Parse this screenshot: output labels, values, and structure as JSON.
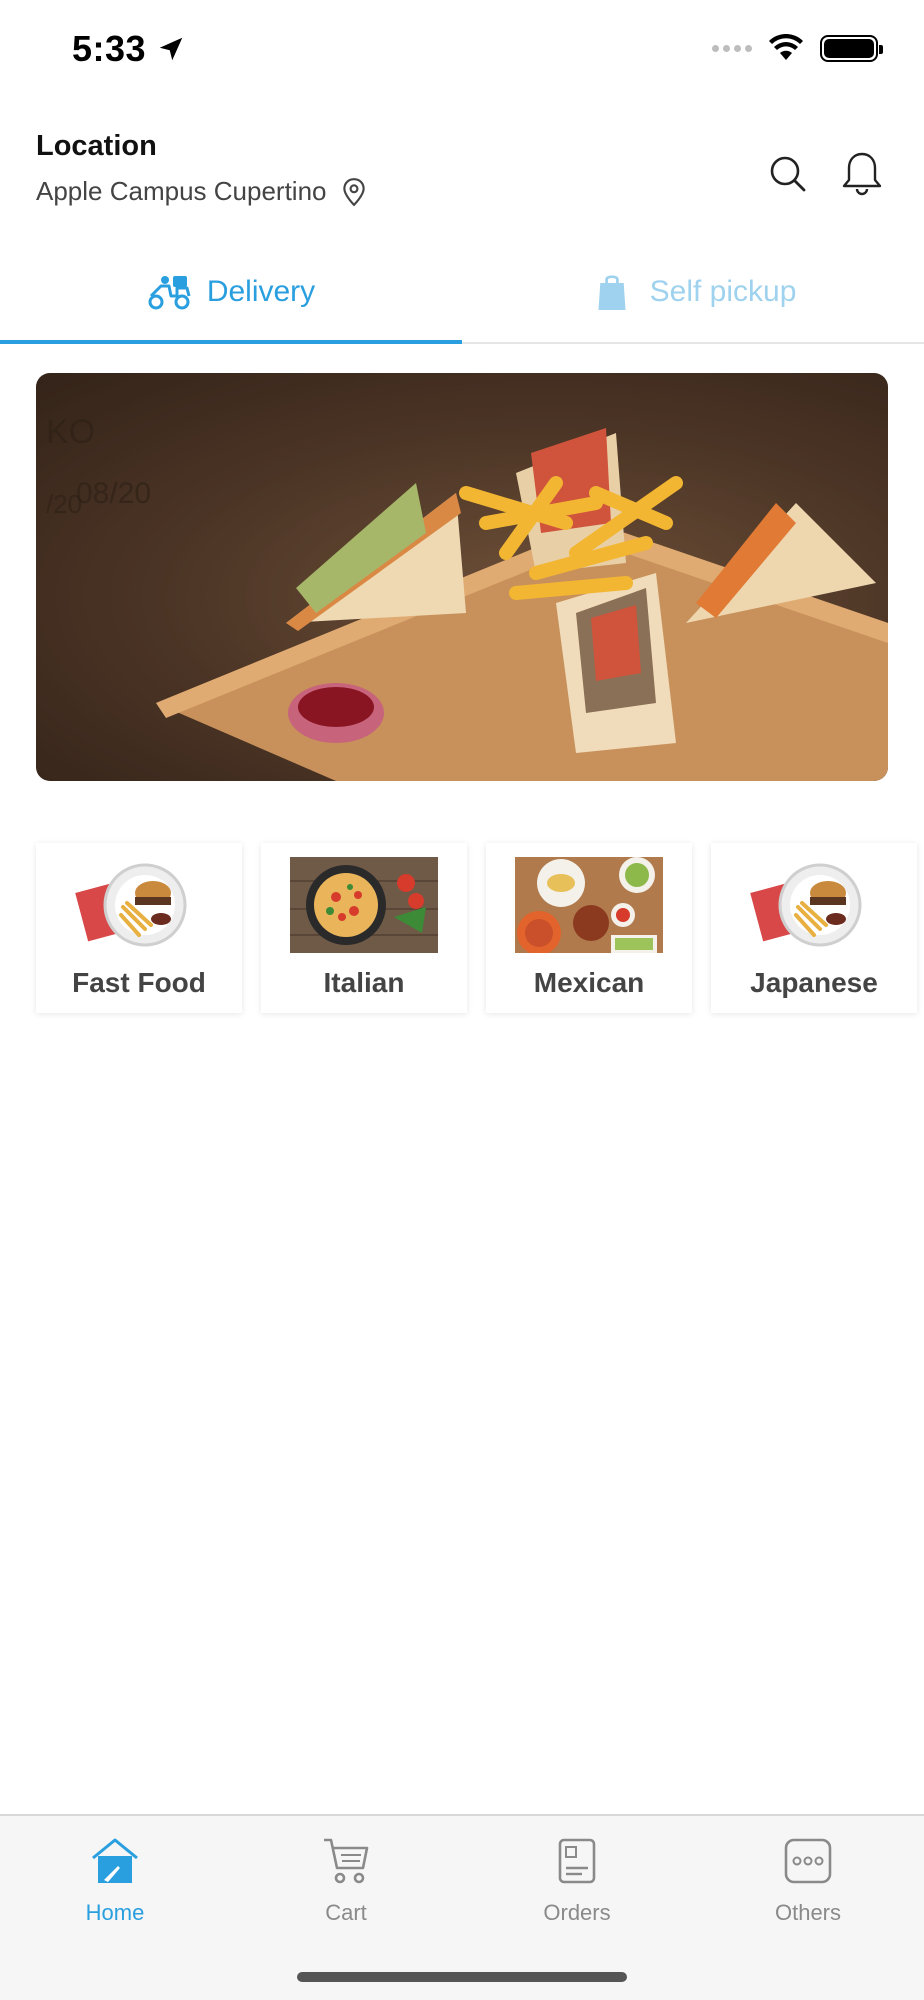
{
  "status_bar": {
    "time": "5:33"
  },
  "header": {
    "location_title": "Location",
    "location_value": "Apple Campus Cupertino"
  },
  "tabs": [
    {
      "label": "Delivery",
      "icon": "scooter-icon",
      "active": true
    },
    {
      "label": "Self pickup",
      "icon": "shopping-bag-icon",
      "active": false
    }
  ],
  "banner": {
    "image": "club sandwich with fries and ketchup on a wooden board"
  },
  "categories": [
    {
      "label": "Fast Food",
      "icon": "burger-plate-image"
    },
    {
      "label": "Italian",
      "icon": "pasta-image"
    },
    {
      "label": "Mexican",
      "icon": "mexican-dishes-image"
    },
    {
      "label": "Japanese",
      "icon": "burger-plate-image"
    }
  ],
  "bottom_nav": [
    {
      "label": "Home",
      "icon": "home-icon",
      "active": true
    },
    {
      "label": "Cart",
      "icon": "cart-icon",
      "active": false
    },
    {
      "label": "Orders",
      "icon": "orders-icon",
      "active": false
    },
    {
      "label": "Others",
      "icon": "more-icon",
      "active": false
    }
  ],
  "colors": {
    "accent": "#2a9fdf",
    "accent_light": "#9fd2ee",
    "nav_inactive": "#8a8a8a"
  }
}
